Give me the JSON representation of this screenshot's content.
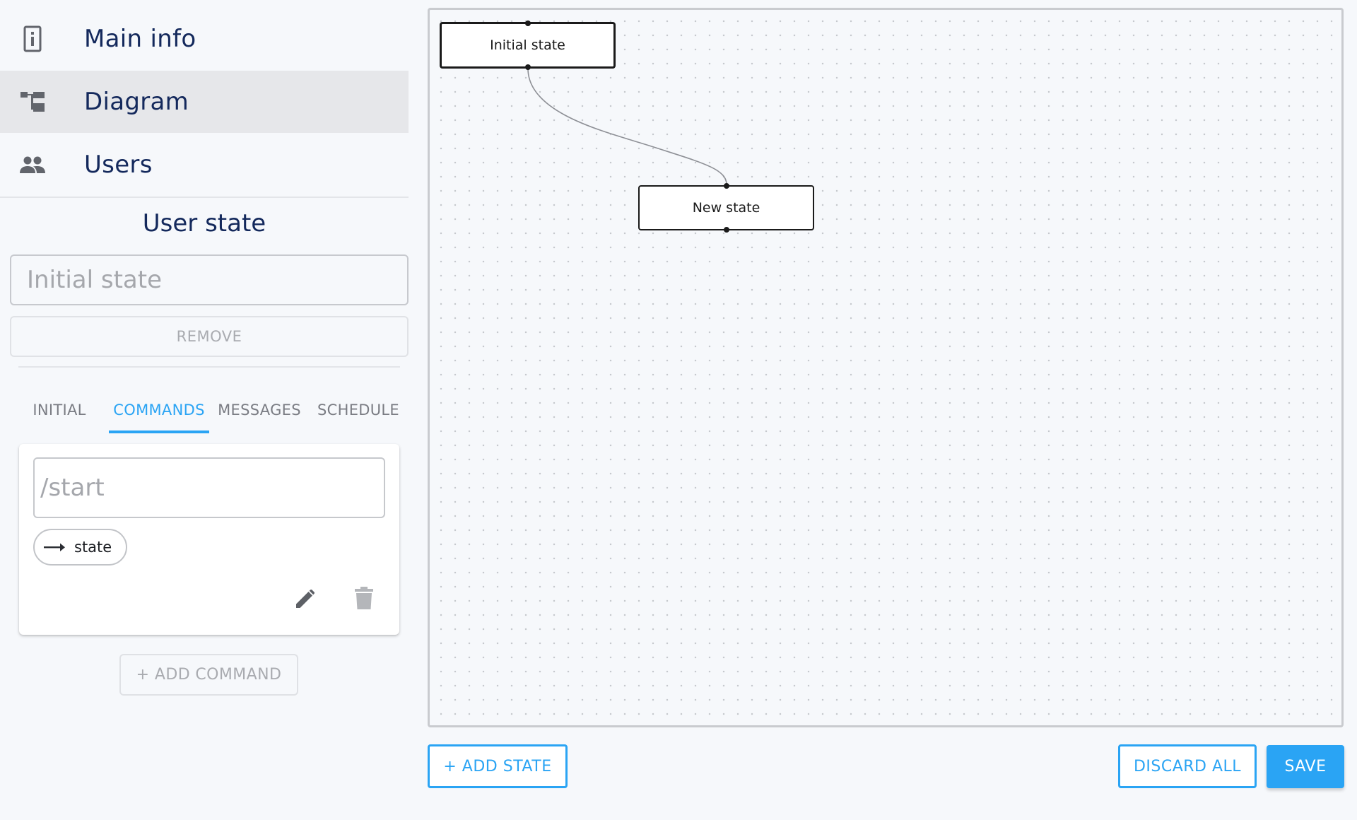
{
  "sidebar": {
    "nav": [
      {
        "label": "Main info",
        "icon": "info-icon"
      },
      {
        "label": "Diagram",
        "icon": "diagram-icon",
        "active": true
      },
      {
        "label": "Users",
        "icon": "users-icon"
      }
    ]
  },
  "state_panel": {
    "title": "User state",
    "name_placeholder": "Initial state",
    "remove_label": "REMOVE",
    "tabs": [
      {
        "label": "INITIAL"
      },
      {
        "label": "COMMANDS",
        "active": true
      },
      {
        "label": "MESSAGES"
      },
      {
        "label": "SCHEDULE"
      }
    ],
    "command": {
      "placeholder": "/start",
      "chip_label": "state",
      "chip_icon": "arrow-right-icon",
      "edit_icon": "pencil-icon",
      "delete_icon": "trash-icon"
    },
    "add_command_label": "+ ADD COMMAND"
  },
  "diagram": {
    "nodes": [
      {
        "label": "Initial state",
        "selected": true
      },
      {
        "label": "New state",
        "selected": false
      }
    ],
    "edges": [
      {
        "from": "Initial state",
        "to": "New state"
      }
    ]
  },
  "actions": {
    "add_state_label": "+ ADD STATE",
    "discard_label": "DISCARD ALL",
    "save_label": "SAVE"
  },
  "colors": {
    "accent": "#2aa4f4",
    "text_dark": "#14295c",
    "nav_active_bg": "#e6e7ea"
  }
}
